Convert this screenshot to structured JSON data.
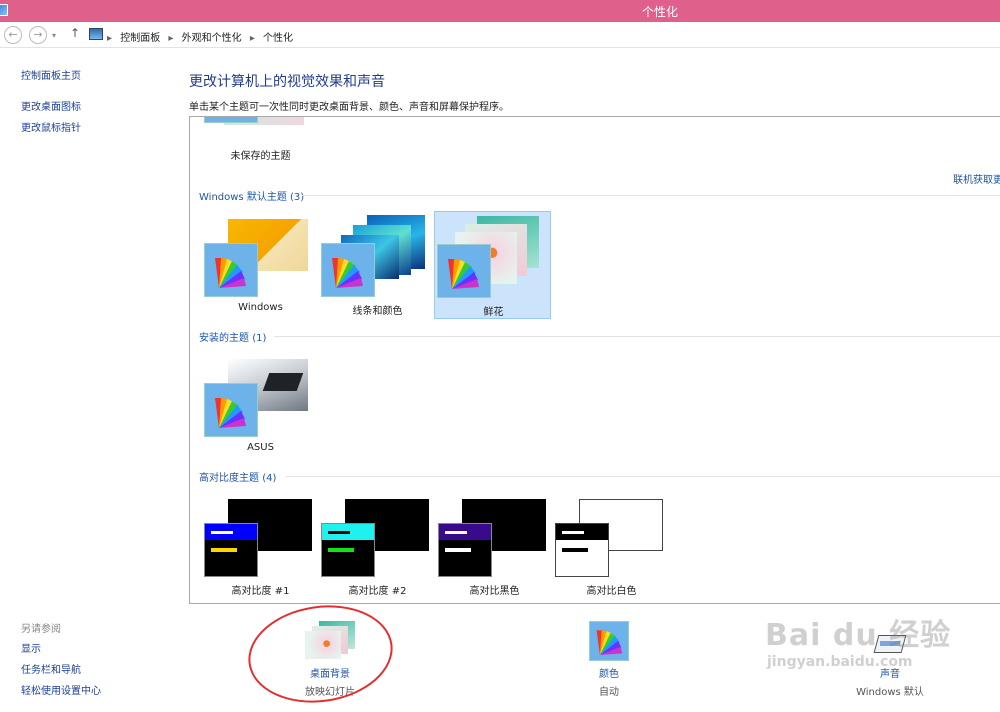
{
  "window": {
    "title": "个性化"
  },
  "address": {
    "crumbs": [
      "控制面板",
      "外观和个性化",
      "个性化"
    ]
  },
  "nav": {
    "home": "控制面板主页",
    "links": [
      "更改桌面图标",
      "更改鼠标指针"
    ],
    "see_also_title": "另请参阅",
    "see_also": [
      "显示",
      "任务栏和导航",
      "轻松使用设置中心"
    ]
  },
  "main": {
    "heading": "更改计算机上的视觉效果和声音",
    "subheading": "单击某个主题可一次性同时更改桌面背景、颜色、声音和屏幕保护程序。",
    "get_more": "联机获取更",
    "unsaved_label": "未保存的主题",
    "groups": [
      {
        "title": "Windows 默认主题",
        "count": "(3)"
      },
      {
        "title": "安装的主题",
        "count": "(1)"
      },
      {
        "title": "高对比度主题",
        "count": "(4)"
      }
    ],
    "default_themes": [
      "Windows",
      "线条和颜色",
      "鲜花"
    ],
    "installed_themes": [
      "ASUS"
    ],
    "contrast_themes": [
      "高对比度 #1",
      "高对比度 #2",
      "高对比黑色",
      "高对比白色"
    ]
  },
  "bottom": {
    "background": {
      "label": "桌面背景",
      "sub": "放映幻灯片"
    },
    "color": {
      "label": "颜色",
      "sub": "自动"
    },
    "sound": {
      "label": "声音",
      "sub": "Windows 默认"
    }
  },
  "watermark": {
    "line1": "Bai du 经验",
    "line2": "jingyan.baidu.com"
  },
  "colors": {
    "titlebar": "#e0608c",
    "link": "#1c3f94",
    "selected": "#cce4fb",
    "annotation": "#e03030"
  }
}
